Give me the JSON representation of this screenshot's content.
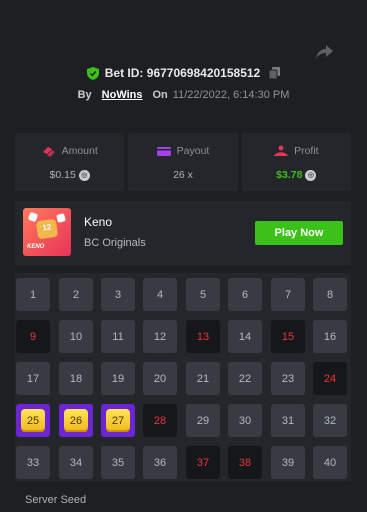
{
  "bet": {
    "id_label": "Bet ID: 96770698420158512",
    "by_label": "By",
    "user": "NoWins",
    "on_label": "On",
    "date": "11/22/2022, 6:14:30 PM"
  },
  "stats": [
    {
      "label": "Amount",
      "value": "$0.15",
      "icon": "coins-icon",
      "icon_color": "#e8335a"
    },
    {
      "label": "Payout",
      "value": "26 x",
      "icon": "wallet-icon",
      "icon_color": "#a640e8"
    },
    {
      "label": "Profit",
      "value": "$3.78",
      "icon": "profit-icon",
      "icon_color": "#e8335a"
    }
  ],
  "game": {
    "thumb_number": "12",
    "thumb_label": "KENO",
    "name": "Keno",
    "provider": "BC Originals",
    "play_label": "Play Now"
  },
  "grid": {
    "numbers": [
      "1",
      "2",
      "3",
      "4",
      "5",
      "6",
      "7",
      "8",
      "9",
      "10",
      "11",
      "12",
      "13",
      "14",
      "15",
      "16",
      "17",
      "18",
      "19",
      "20",
      "21",
      "22",
      "23",
      "24",
      "25",
      "26",
      "27",
      "28",
      "29",
      "30",
      "31",
      "32",
      "33",
      "34",
      "35",
      "36",
      "37",
      "38",
      "39",
      "40"
    ],
    "drawn": [
      9,
      13,
      15,
      24,
      28,
      37,
      38
    ],
    "hits": [
      25,
      26,
      27
    ]
  },
  "server_seed_label": "Server Seed",
  "colors": {
    "accent_green": "#3bc117",
    "hit_purple": "#6b25d4",
    "miss_red": "#e8363c"
  }
}
